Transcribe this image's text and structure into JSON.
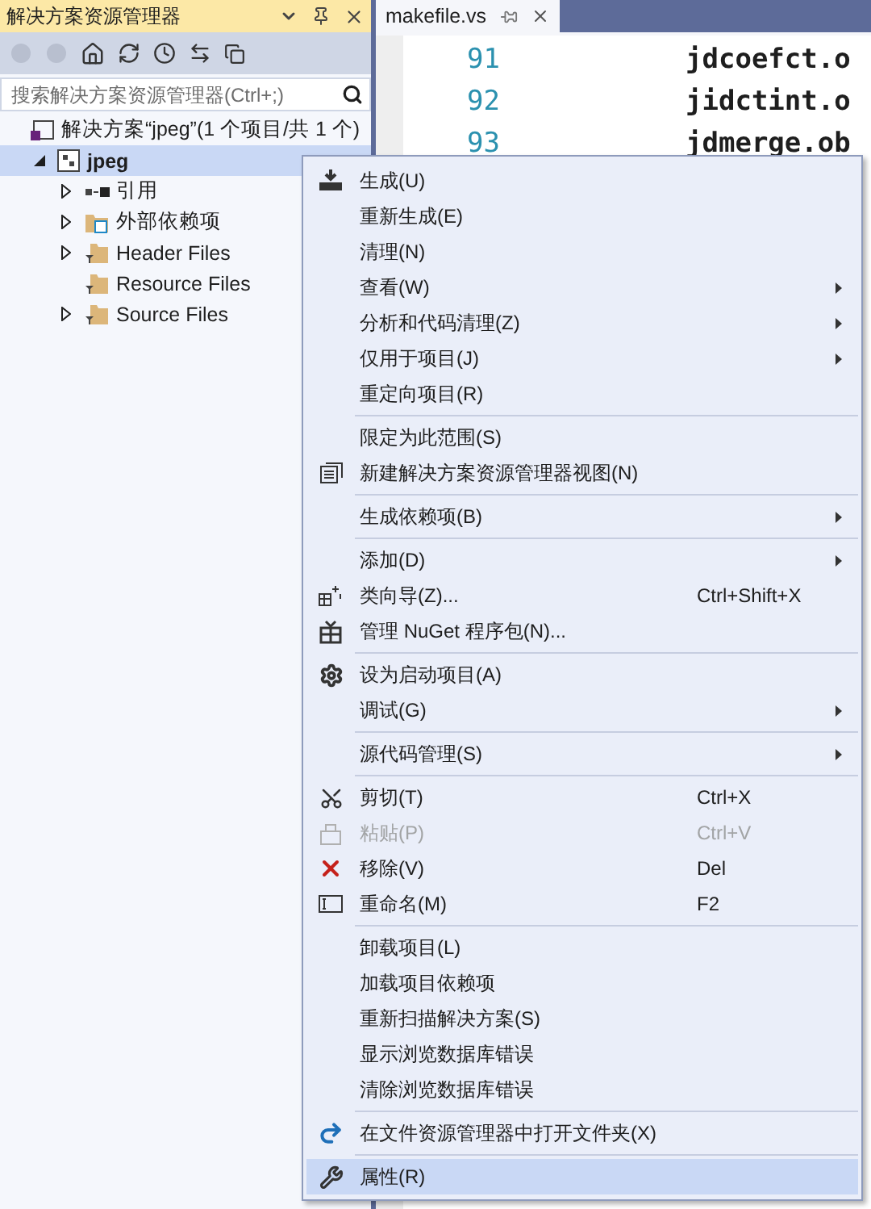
{
  "solution_explorer": {
    "title": "解决方案资源管理器",
    "search": {
      "placeholder": "搜索解决方案资源管理器(Ctrl+;)"
    },
    "tree": [
      {
        "label": "解决方案“jpeg”(1 个项目/共 1 个)",
        "kind": "solution",
        "selected": false,
        "children": [
          {
            "label": "jpeg",
            "kind": "project",
            "selected": true,
            "expanded": true,
            "children": [
              {
                "label": "引用",
                "kind": "references",
                "selected": false,
                "expanded": false
              },
              {
                "label": "外部依赖项",
                "kind": "external",
                "selected": false,
                "expanded": false
              },
              {
                "label": "Header Files",
                "kind": "filter",
                "selected": false,
                "expanded": false
              },
              {
                "label": "Resource Files",
                "kind": "filter",
                "selected": false
              },
              {
                "label": "Source Files",
                "kind": "filter",
                "selected": false,
                "expanded": false
              }
            ]
          }
        ]
      }
    ]
  },
  "editor": {
    "tab": {
      "label": "makefile.vs"
    },
    "lines": [
      {
        "number": "91",
        "code": "jdcoefct.o"
      },
      {
        "number": "92",
        "code": "jidctint.o"
      },
      {
        "number": "93",
        "code": "jdmerge.ob"
      }
    ]
  },
  "context_menu": {
    "items": [
      {
        "kind": "build",
        "label": "生成(U)",
        "selected": false,
        "disabled": false
      },
      {
        "kind": "plain",
        "label": "重新生成(E)",
        "selected": false,
        "disabled": false
      },
      {
        "kind": "plain",
        "label": "清理(N)",
        "selected": false,
        "disabled": false
      },
      {
        "kind": "plain",
        "label": "查看(W)",
        "submenu": true,
        "selected": false,
        "disabled": false
      },
      {
        "kind": "plain",
        "label": "分析和代码清理(Z)",
        "submenu": true,
        "selected": false,
        "disabled": false
      },
      {
        "kind": "plain",
        "label": "仅用于项目(J)",
        "submenu": true,
        "selected": false,
        "disabled": false
      },
      {
        "kind": "plain",
        "label": "重定向项目(R)",
        "selected": false,
        "disabled": false
      },
      {
        "kind": "separator"
      },
      {
        "kind": "plain",
        "label": "限定为此范围(S)",
        "selected": false,
        "disabled": false
      },
      {
        "kind": "newview",
        "label": "新建解决方案资源管理器视图(N)",
        "selected": false,
        "disabled": false
      },
      {
        "kind": "separator"
      },
      {
        "kind": "plain",
        "label": "生成依赖项(B)",
        "submenu": true,
        "selected": false,
        "disabled": false
      },
      {
        "kind": "separator"
      },
      {
        "kind": "plain",
        "label": "添加(D)",
        "submenu": true,
        "selected": false,
        "disabled": false
      },
      {
        "kind": "wizard",
        "label": "类向导(Z)...",
        "shortcut": "Ctrl+Shift+X",
        "selected": false,
        "disabled": false
      },
      {
        "kind": "package",
        "label": "管理 NuGet 程序包(N)...",
        "selected": false,
        "disabled": false
      },
      {
        "kind": "separator"
      },
      {
        "kind": "gear",
        "label": "设为启动项目(A)",
        "selected": false,
        "disabled": false
      },
      {
        "kind": "plain",
        "label": "调试(G)",
        "submenu": true,
        "selected": false,
        "disabled": false
      },
      {
        "kind": "separator"
      },
      {
        "kind": "plain",
        "label": "源代码管理(S)",
        "submenu": true,
        "selected": false,
        "disabled": false
      },
      {
        "kind": "separator"
      },
      {
        "kind": "cut",
        "label": "剪切(T)",
        "shortcut": "Ctrl+X",
        "selected": false,
        "disabled": false
      },
      {
        "kind": "paste",
        "label": "粘贴(P)",
        "shortcut": "Ctrl+V",
        "selected": false,
        "disabled": true
      },
      {
        "kind": "remove",
        "label": "移除(V)",
        "shortcut": "Del",
        "selected": false,
        "disabled": false
      },
      {
        "kind": "rename",
        "label": "重命名(M)",
        "shortcut": "F2",
        "selected": false,
        "disabled": false
      },
      {
        "kind": "separator"
      },
      {
        "kind": "plain",
        "label": "卸载项目(L)",
        "selected": false,
        "disabled": false
      },
      {
        "kind": "plain",
        "label": "加载项目依赖项",
        "selected": false,
        "disabled": false
      },
      {
        "kind": "plain",
        "label": "重新扫描解决方案(S)",
        "selected": false,
        "disabled": false
      },
      {
        "kind": "plain",
        "label": "显示浏览数据库错误",
        "selected": false,
        "disabled": false
      },
      {
        "kind": "plain",
        "label": "清除浏览数据库错误",
        "selected": false,
        "disabled": false
      },
      {
        "kind": "separator"
      },
      {
        "kind": "open",
        "label": "在文件资源管理器中打开文件夹(X)",
        "selected": false,
        "disabled": false
      },
      {
        "kind": "separator"
      },
      {
        "kind": "wrench",
        "label": "属性(R)",
        "selected": true,
        "disabled": false
      }
    ]
  }
}
